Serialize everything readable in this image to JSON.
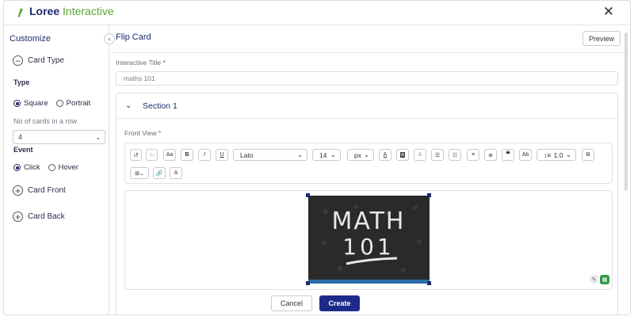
{
  "app": {
    "brand_bold": "Loree",
    "brand_light": "Interactive",
    "close_glyph": "✕"
  },
  "sidebar": {
    "title": "Customize",
    "card_type": {
      "label": "Card Type",
      "icon": "minus-circle-icon"
    },
    "type_label": "Type",
    "type_options": [
      {
        "label": "Square",
        "selected": true
      },
      {
        "label": "Portrait",
        "selected": false
      }
    ],
    "cards_row_label": "No of cards in a row",
    "cards_row_value": "4",
    "event_label": "Event",
    "event_options": [
      {
        "label": "Click",
        "selected": true
      },
      {
        "label": "Hover",
        "selected": false
      }
    ],
    "card_front": {
      "label": "Card Front",
      "icon": "plus-circle-icon"
    },
    "card_back": {
      "label": "Card Back",
      "icon": "plus-circle-icon"
    }
  },
  "main": {
    "title": "Flip Card",
    "preview_label": "Preview",
    "interactive_title_label": "Interactive Title *",
    "interactive_title_value": "maths 101",
    "section_title": "Section 1",
    "front_view_label": "Front View *"
  },
  "toolbar": {
    "font_family": "Lato",
    "font_size": "14",
    "unit": "px",
    "line_height": "1.0",
    "aa_label": "Aa",
    "bold": "B",
    "italic": "I",
    "underline": "U",
    "ab_label": "Ab",
    "clear_format": "A"
  },
  "image": {
    "text_line1": "MATH",
    "text_line2": "101"
  },
  "footer": {
    "cancel_label": "Cancel",
    "create_label": "Create"
  },
  "colors": {
    "brand_navy": "#1d2a6b",
    "brand_green": "#5aa832",
    "primary_button": "#1d2a8a"
  }
}
